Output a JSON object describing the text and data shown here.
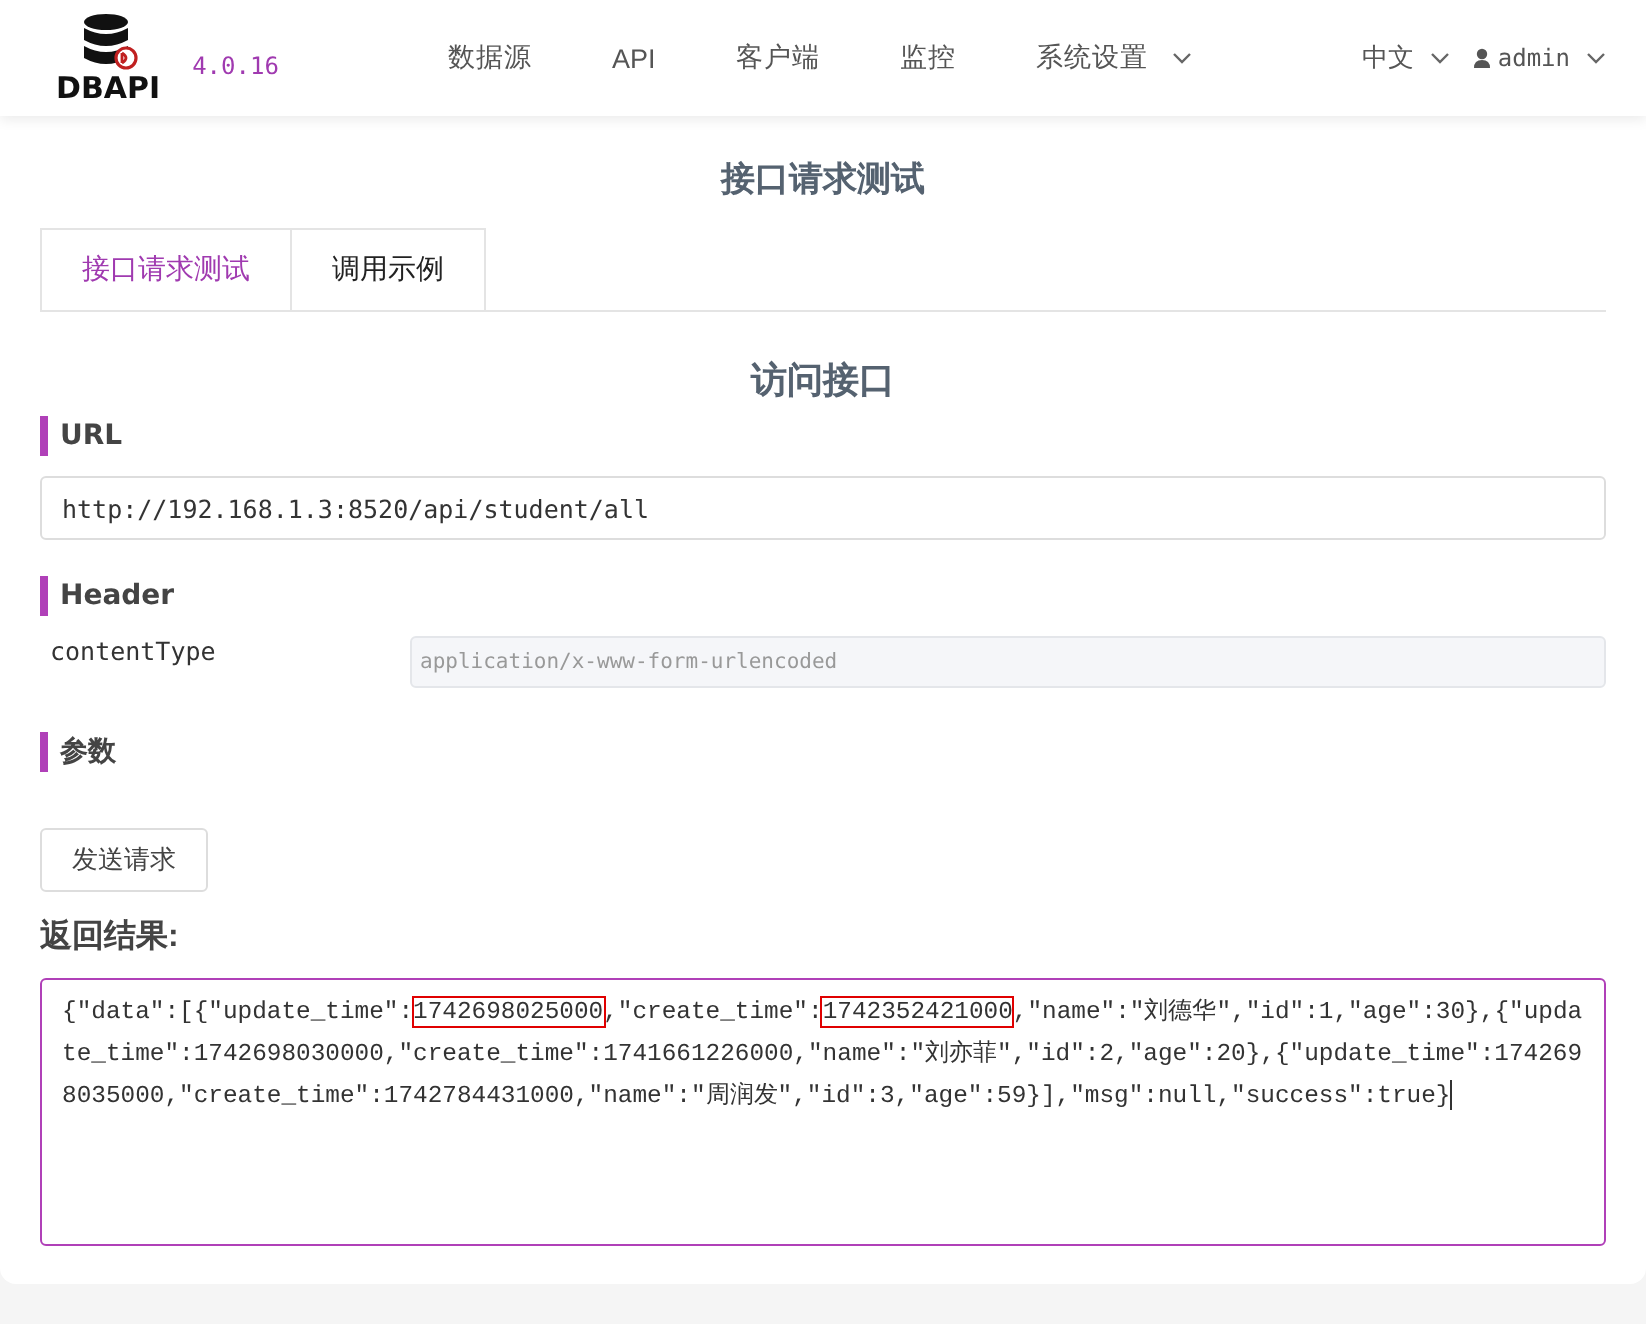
{
  "header": {
    "logo_text": "DBAPI",
    "version": "4.0.16",
    "nav": [
      {
        "label": "数据源",
        "dropdown": false
      },
      {
        "label": "API",
        "dropdown": false
      },
      {
        "label": "客户端",
        "dropdown": false
      },
      {
        "label": "监控",
        "dropdown": false
      },
      {
        "label": "系统设置",
        "dropdown": true
      }
    ],
    "language": "中文",
    "user": "admin"
  },
  "page_title": "接口请求测试",
  "tabs": [
    {
      "label": "接口请求测试",
      "selected": true
    },
    {
      "label": "调用示例",
      "selected": false
    }
  ],
  "section_title": "访问接口",
  "url": {
    "label": "URL",
    "value": "http://192.168.1.3:8520/api/student/all"
  },
  "header_section": {
    "label": "Header",
    "params": [
      {
        "name": "contentType",
        "value": "application/x-www-form-urlencoded"
      }
    ]
  },
  "params_section": {
    "label": "参数"
  },
  "send_button": "发送请求",
  "result": {
    "label": "返回结果:",
    "segments": [
      {
        "text": "{\"data\":[{\"update_time\":",
        "highlighted": false
      },
      {
        "text": "1742698025000",
        "highlighted": true
      },
      {
        "text": ",\"create_time\":",
        "highlighted": false
      },
      {
        "text": "1742352421000",
        "highlighted": true
      },
      {
        "text": ",\"name\":\"刘德华\",\"id\":1,\"age\":30},{\"update_time\":1742698030000,\"create_time\":1741661226000,\"name\":\"刘亦菲\",\"id\":2,\"age\":20},{\"update_time\":1742698035000,\"create_time\":1742784431000,\"name\":\"周润发\",\"id\":3,\"age\":59}],\"msg\":null,\"success\":true}",
        "highlighted": false
      }
    ]
  }
}
